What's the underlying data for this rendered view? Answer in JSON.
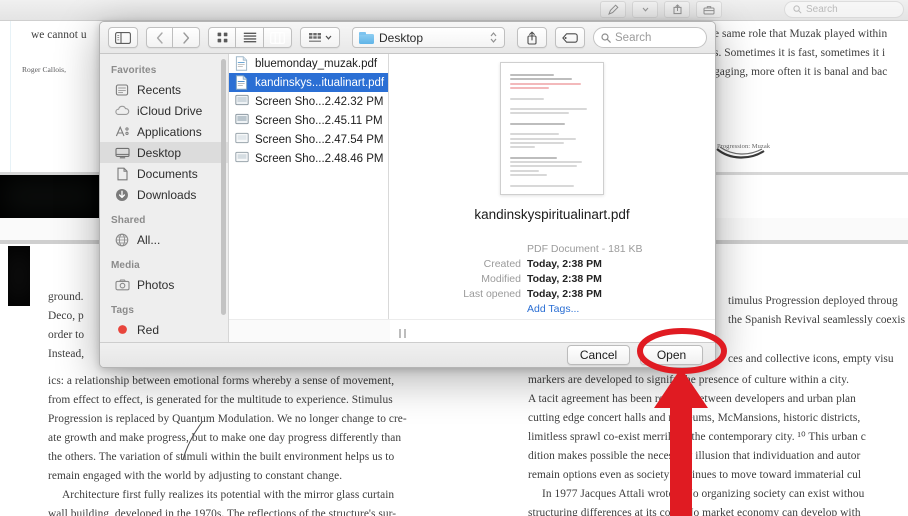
{
  "background_app": {
    "toolbar": {
      "icons": [
        "markup-pen-icon",
        "chevron-down-icon",
        "share-icon",
        "toolbox-icon"
      ],
      "search_placeholder": "Search"
    },
    "document": {
      "left_fragments": [
        "we cannot u",
        "Roger Callois,"
      ],
      "right_fragments": [
        "e same role that Muzak played within",
        "s. Sometimes it is fast, sometimes it i",
        "gaging, more often it is banal and bac"
      ],
      "figure_caption": "Progression: Muzak",
      "left_column_stubs": [
        "ground.",
        "Deco, p",
        "order to",
        "Instead,"
      ],
      "left_column_lines": [
        "ics: a relationship between emotional forms whereby a sense of movement,",
        "from effect to effect, is generated for the multitude to experience. Stimulus",
        "Progression is replaced by Quantum Modulation. We no longer change to cre-",
        "ate growth and make progress, but to make one day progress differently than",
        "the others. The variation of stimuli within the built environment helps us to",
        "remain engaged with the world by adjusting to constant change.",
        "Architecture first fully realizes its potential with the mirror glass curtain",
        "wall building, developed in the 1970s. The reflections of the structure's sur-"
      ],
      "right_column_lines": [
        "timulus Progression deployed throug",
        "the Spanish Revival seamlessly coexis",
        "ces and collective icons, empty visu",
        "markers are developed to signify the presence of culture within a city.",
        "A tacit agreement has been reached between developers and urban plan",
        "cutting edge concert halls and museums, McMansions, historic districts,",
        "limitless sprawl co-exist merrily in the contemporary city. ¹⁰ This urban c",
        "dition makes possible the necessary illusion that individuation and autor",
        "remain options even as society continues to move toward immaterial cul",
        "In 1977 Jacques Attali wrote: \"No organizing society can exist withou",
        "structuring differences at its core. No market economy can develop with"
      ]
    }
  },
  "dialog": {
    "toolbar": {
      "sidebar_toggle": "sidebar-toggle-icon",
      "back_label": "back",
      "forward_label": "forward",
      "view_icon_grid": "icon-view-icon",
      "view_list": "list-view-icon",
      "view_column": "column-view-icon",
      "group_by": "group-by-icon",
      "path_label": "Desktop",
      "search_placeholder": "Search"
    },
    "sidebar": {
      "sections": [
        {
          "title": "Favorites",
          "items": [
            {
              "label": "Recents",
              "icon": "clock-recents-icon",
              "selected": false
            },
            {
              "label": "iCloud Drive",
              "icon": "cloud-icon",
              "selected": false
            },
            {
              "label": "Applications",
              "icon": "applications-icon",
              "selected": false
            },
            {
              "label": "Desktop",
              "icon": "desktop-icon",
              "selected": true
            },
            {
              "label": "Documents",
              "icon": "documents-icon",
              "selected": false
            },
            {
              "label": "Downloads",
              "icon": "downloads-icon",
              "selected": false
            }
          ]
        },
        {
          "title": "Shared",
          "items": [
            {
              "label": "All...",
              "icon": "network-globe-icon",
              "selected": false
            }
          ]
        },
        {
          "title": "Media",
          "items": [
            {
              "label": "Photos",
              "icon": "photos-camera-icon",
              "selected": false
            }
          ]
        },
        {
          "title": "Tags",
          "items": []
        }
      ]
    },
    "files": [
      {
        "name": "bluemonday_muzak.pdf",
        "icon": "pdf-file-icon",
        "selected": false
      },
      {
        "name": "kandinskys...itualinart.pdf",
        "icon": "pdf-file-icon",
        "selected": true
      },
      {
        "name": "Screen Sho...2.42.32 PM",
        "icon": "screenshot-file-icon",
        "selected": false
      },
      {
        "name": "Screen Sho...2.45.11 PM",
        "icon": "screenshot-file-icon",
        "selected": false
      },
      {
        "name": "Screen Sho...2.47.54 PM",
        "icon": "screenshot-file-icon",
        "selected": false
      },
      {
        "name": "Screen Sho...2.48.46 PM",
        "icon": "screenshot-file-icon",
        "selected": false
      }
    ],
    "preview": {
      "filename": "kandinskyspiritualinart.pdf",
      "kind": "PDF Document - 181 KB",
      "created_key": "Created",
      "created_value": "Today, 2:38 PM",
      "modified_key": "Modified",
      "modified_value": "Today, 2:38 PM",
      "last_opened_key": "Last opened",
      "last_opened_value": "Today, 2:38 PM",
      "add_tags": "Add Tags..."
    },
    "footer": {
      "cancel_label": "Cancel",
      "open_label": "Open"
    }
  },
  "annotations": {
    "ellipse": {
      "target": "Open",
      "color": "#e01b22"
    },
    "arrow": {
      "direction": "up",
      "target": "Open",
      "color": "#e01b22"
    }
  },
  "colors": {
    "selection_blue": "#2b6fd4",
    "annotation_red": "#e01b22",
    "link_blue": "#2b6fd4",
    "dialog_chrome": "#ececec"
  }
}
